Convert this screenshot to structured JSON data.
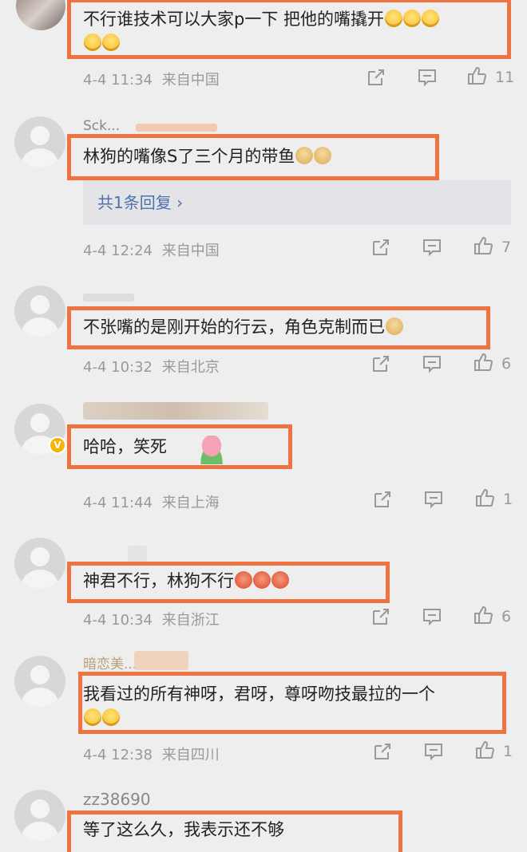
{
  "comments": [
    {
      "username": "",
      "text": "不行谁技术可以大家p一下  把他的嘴撬开",
      "date": "4-4 11:34",
      "location": "来自中国",
      "likes": "11",
      "emoji": [
        "laugh-emoji",
        "laugh-emoji",
        "laugh-emoji",
        "laugh-emoji",
        "laugh-emoji"
      ]
    },
    {
      "username": "Sck...",
      "text": "林狗的嘴像S了三个月的带鱼",
      "reply_link": "共1条回复",
      "reply_chevron": "›",
      "date": "4-4 12:24",
      "location": "来自中国",
      "likes": "7",
      "emoji": [
        "doge-emoji",
        "doge-emoji"
      ]
    },
    {
      "username": "",
      "text": "不张嘴的是刚开始的行云，角色克制而已",
      "date": "4-4 10:32",
      "location": "来自北京",
      "likes": "6",
      "emoji": [
        "doge-emoji"
      ]
    },
    {
      "username": "",
      "text": "哈哈，笑死",
      "date": "4-4 11:44",
      "location": "来自上海",
      "likes": "1",
      "verified_mark": "V",
      "emoji": [
        "lotus-emoji"
      ]
    },
    {
      "username": "",
      "text": "神君不行，林狗不行",
      "date": "4-4 10:34",
      "location": "来自浙江",
      "likes": "6",
      "emoji": [
        "angry-emoji",
        "angry-emoji",
        "angry-emoji"
      ]
    },
    {
      "username": "暗恋美...",
      "text": "我看过的所有神呀，君呀，尊呀吻技最拉的一个",
      "date": "4-4 12:38",
      "location": "来自四川",
      "likes": "1",
      "emoji": [
        "laugh-emoji",
        "laugh-emoji"
      ]
    },
    {
      "username": "zz38690",
      "text": "等了这么久，我表示还不够",
      "emoji": []
    }
  ],
  "colors": {
    "highlight": "#ee7340",
    "reply_link": "#4a73a8",
    "background": "#eeeeee",
    "meta": "#999999"
  },
  "icons": {
    "share": "share-icon",
    "comment": "comment-icon",
    "like": "thumbs-up-icon"
  }
}
